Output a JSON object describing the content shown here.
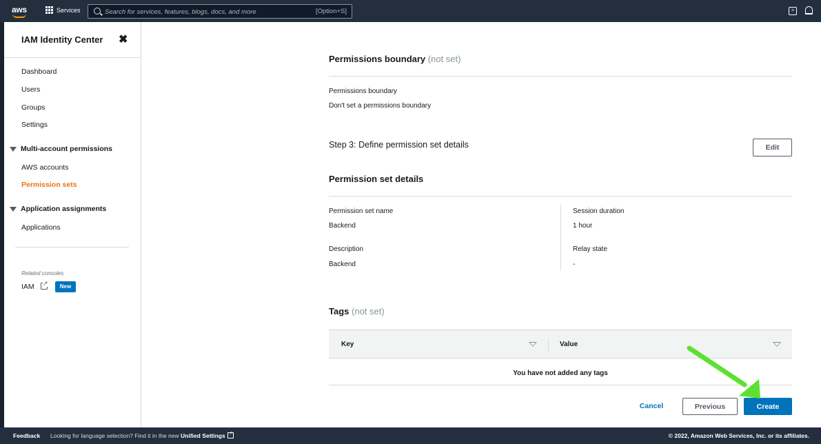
{
  "topnav": {
    "logo": "aws",
    "services_label": "Services",
    "search_placeholder": "Search for services, features, blogs, docs, and more",
    "search_shortcut": "[Option+S]"
  },
  "sidebar": {
    "title": "IAM Identity Center",
    "items": [
      {
        "label": "Dashboard"
      },
      {
        "label": "Users"
      },
      {
        "label": "Groups"
      },
      {
        "label": "Settings"
      }
    ],
    "sections": [
      {
        "label": "Multi-account permissions",
        "items": [
          {
            "label": "AWS accounts"
          },
          {
            "label": "Permission sets",
            "active": true
          }
        ]
      },
      {
        "label": "Application assignments",
        "items": [
          {
            "label": "Applications"
          }
        ]
      }
    ],
    "related_label": "Related consoles",
    "related_item": "IAM",
    "new_badge": "New"
  },
  "main": {
    "permissions_boundary": {
      "heading": "Permissions boundary",
      "heading_note": "(not set)",
      "field_label": "Permissions boundary",
      "field_value": "Don't set a permissions boundary"
    },
    "step3": {
      "title": "Step 3: Define permission set details",
      "edit_label": "Edit"
    },
    "details": {
      "heading": "Permission set details",
      "name_label": "Permission set name",
      "name_value": "Backend",
      "description_label": "Description",
      "description_value": "Backend",
      "session_label": "Session duration",
      "session_value": "1 hour",
      "relay_label": "Relay state",
      "relay_value": "-"
    },
    "tags": {
      "heading": "Tags",
      "heading_note": "(not set)",
      "columns": [
        "Key",
        "Value"
      ],
      "empty_message": "You have not added any tags"
    },
    "actions": {
      "cancel": "Cancel",
      "previous": "Previous",
      "create": "Create"
    }
  },
  "footer": {
    "feedback": "Feedback",
    "language_text": "Looking for language selection? Find it in the new",
    "language_link": "Unified Settings",
    "copyright": "© 2022, Amazon Web Services, Inc. or its affiliates."
  },
  "colors": {
    "nav_bg": "#232f3e",
    "accent_orange": "#ec7211",
    "primary_blue": "#0073bb",
    "annotation_arrow": "#5ce032"
  }
}
